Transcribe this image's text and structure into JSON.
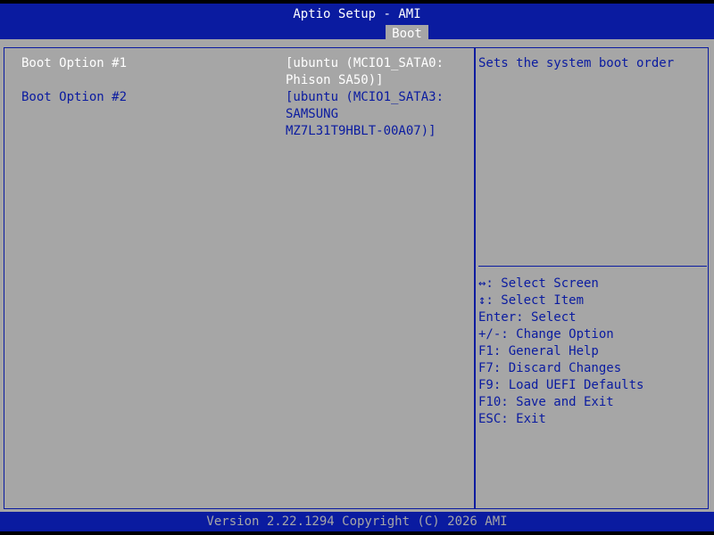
{
  "header": {
    "title": "Aptio Setup - AMI",
    "active_tab": "Boot"
  },
  "options": [
    {
      "label": "Boot Option #1",
      "value_lines": [
        "[ubuntu (MCIO1_SATA0:",
        "Phison SA50)]"
      ],
      "state": "selected"
    },
    {
      "label": "Boot Option #2",
      "value_lines": [
        "[ubuntu (MCIO1_SATA3:",
        "SAMSUNG",
        "MZ7L31T9HBLT-00A07)]"
      ],
      "state": "normal"
    }
  ],
  "help": {
    "description": "Sets the system boot order",
    "keys": [
      "↔: Select Screen",
      "↕: Select Item",
      "Enter: Select",
      "+/-: Change Option",
      "F1: General Help",
      "F7: Discard Changes",
      "F9: Load UEFI Defaults",
      "F10: Save and Exit",
      "ESC: Exit"
    ]
  },
  "footer": {
    "text": "Version 2.22.1294 Copyright (C) 2026 AMI"
  },
  "colors": {
    "bios_blue": "#0a1ba0",
    "panel_gray": "#a6a6a6",
    "highlight_white": "#ffffff"
  }
}
